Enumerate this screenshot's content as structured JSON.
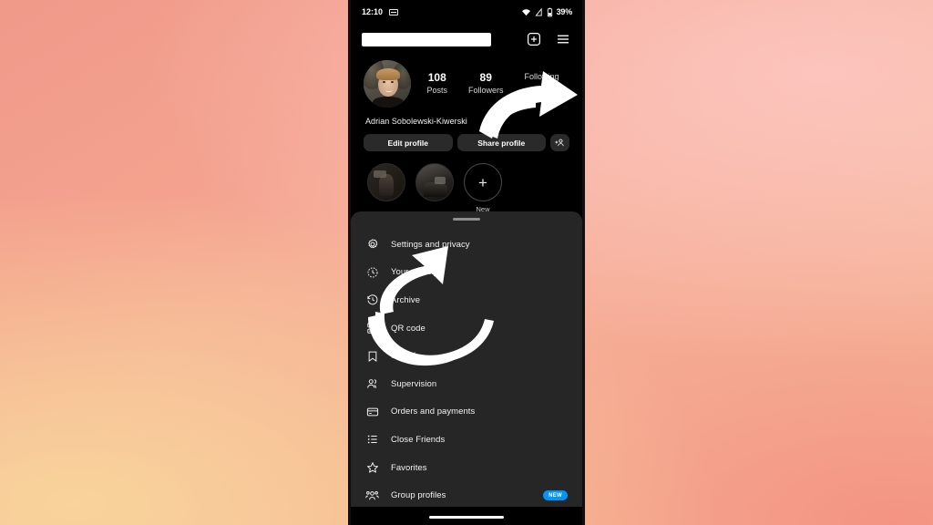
{
  "background": {
    "accent_top_left": "#f09a8a",
    "accent_top_right": "#fcc4bd",
    "accent_bottom_left": "#f3cb9e",
    "accent_bottom_right": "#f49383"
  },
  "phone": {
    "status_bar": {
      "time": "12:10",
      "keyboard_icon": "keyboard-icon",
      "wifi_icon": "wifi-icon",
      "signal_icon": "signal-icon",
      "battery_icon": "battery-icon",
      "battery_percent": "39%"
    },
    "top_bar": {
      "username_redacted": "",
      "add_icon": "plus-square-icon",
      "menu_icon": "hamburger-menu-icon"
    },
    "profile": {
      "avatar_alt": "profile-photo",
      "stats": [
        {
          "value": "108",
          "label": "Posts"
        },
        {
          "value": "89",
          "label": "Followers"
        },
        {
          "value": "",
          "label": "Following"
        }
      ],
      "display_name": "Adrian Sobolewski-Kiwerski",
      "actions": {
        "edit_profile": "Edit profile",
        "share_profile": "Share profile",
        "add_person_icon": "add-person-icon"
      }
    },
    "highlights": [
      {
        "label": "",
        "icon": "story-highlight-1"
      },
      {
        "label": "",
        "icon": "story-highlight-2"
      },
      {
        "label": "New",
        "icon": "plus-icon"
      }
    ],
    "menu_sheet": {
      "grabber": "drag-handle",
      "items": [
        {
          "label": "Settings and privacy",
          "icon": "gear-icon",
          "badge": ""
        },
        {
          "label": "Your activity",
          "icon": "clock-activity-icon",
          "badge": ""
        },
        {
          "label": "Archive",
          "icon": "archive-clock-icon",
          "badge": ""
        },
        {
          "label": "QR code",
          "icon": "qr-code-icon",
          "badge": ""
        },
        {
          "label": "Saved",
          "icon": "bookmark-icon",
          "badge": ""
        },
        {
          "label": "Supervision",
          "icon": "supervision-people-icon",
          "badge": ""
        },
        {
          "label": "Orders and payments",
          "icon": "credit-card-icon",
          "badge": ""
        },
        {
          "label": "Close Friends",
          "icon": "list-icon",
          "badge": ""
        },
        {
          "label": "Favorites",
          "icon": "star-icon",
          "badge": ""
        },
        {
          "label": "Group profiles",
          "icon": "group-profiles-icon",
          "badge": "NEW"
        }
      ]
    },
    "home_indicator": "home-indicator"
  },
  "annotations": {
    "arrow_to_menu": "arrow-pointing-to-hamburger-menu",
    "arrow_to_settings": "arrow-pointing-to-settings-and-privacy",
    "arrow_color": "#ffffff"
  }
}
